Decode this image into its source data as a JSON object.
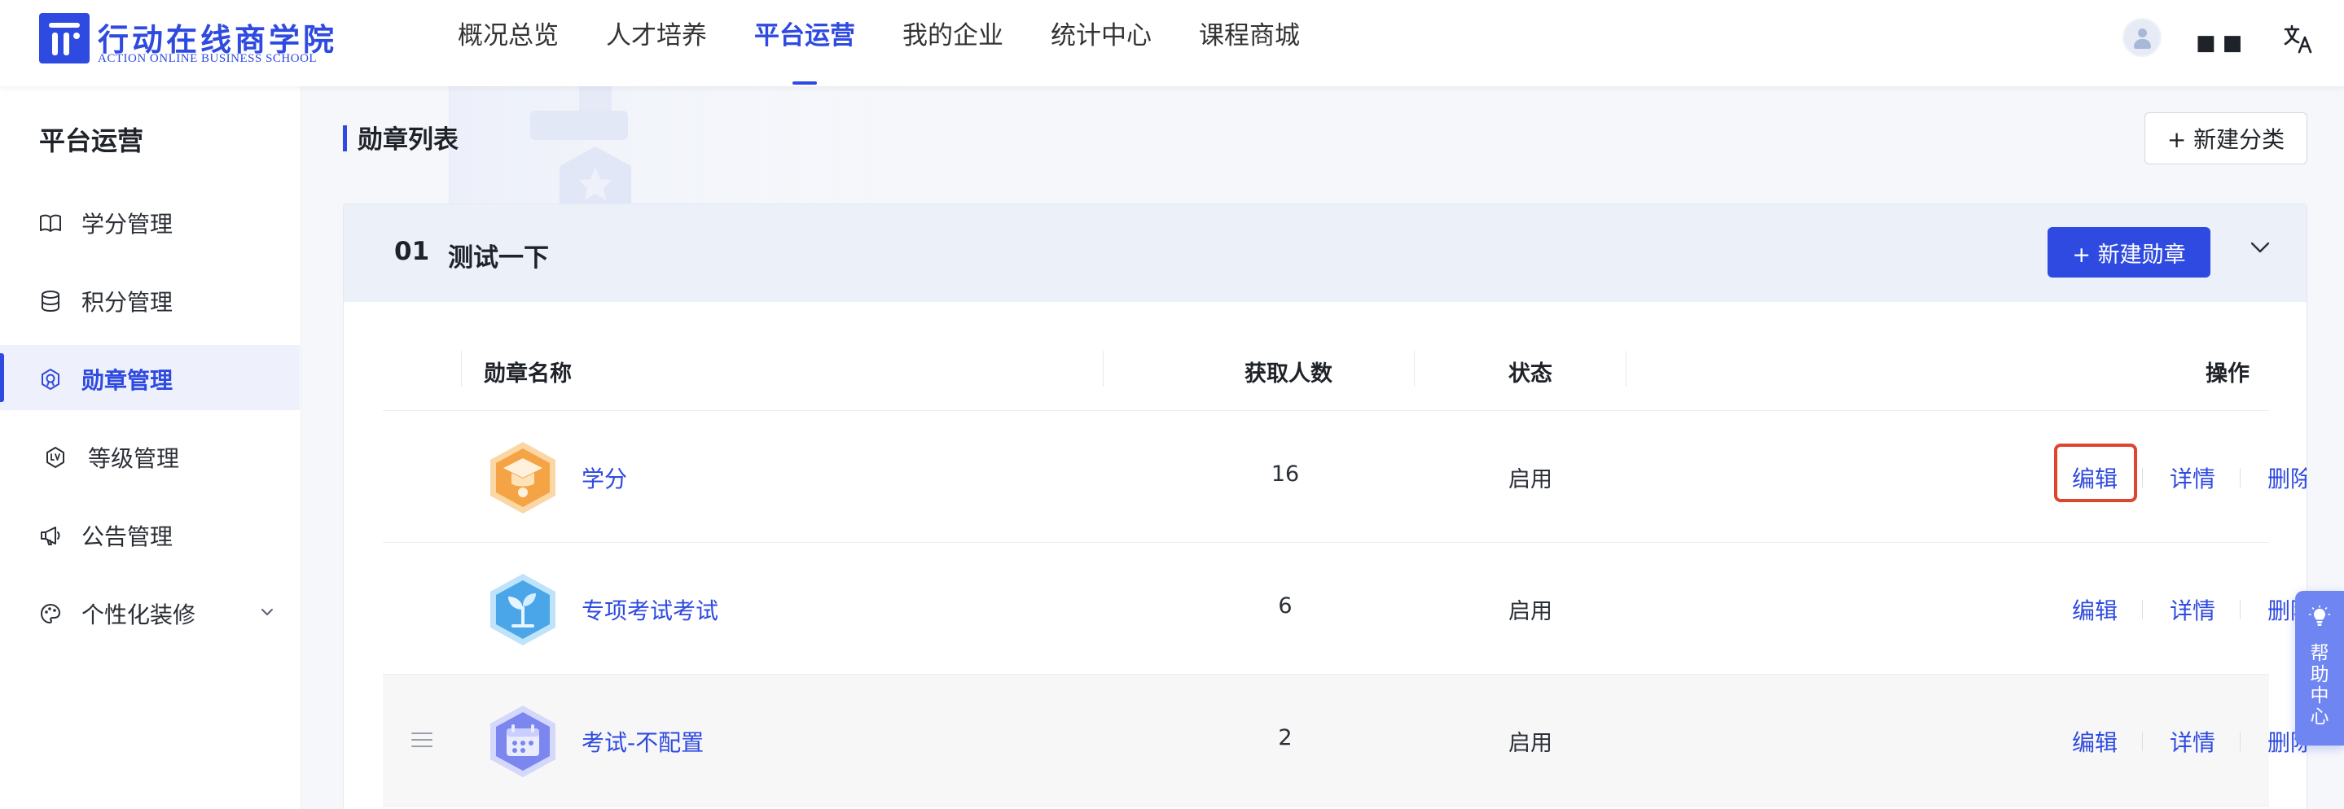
{
  "brand": {
    "name_cn": "行动在线商学院",
    "name_en": "ACTION ONLINE BUSINESS SCHOOL",
    "color": "#2f4ae0"
  },
  "nav": {
    "items": [
      {
        "label": "概况总览"
      },
      {
        "label": "人才培养"
      },
      {
        "label": "平台运营",
        "active": true
      },
      {
        "label": "我的企业"
      },
      {
        "label": "统计中心"
      },
      {
        "label": "课程商城"
      }
    ]
  },
  "user": {
    "avatar_icon": "user-avatar-icon",
    "name": "■■"
  },
  "language_icon": "translate-icon",
  "sidebar": {
    "title": "平台运营",
    "items": [
      {
        "label": "学分管理",
        "icon": "book-icon"
      },
      {
        "label": "积分管理",
        "icon": "database-icon"
      },
      {
        "label": "勋章管理",
        "icon": "medal-icon",
        "active": true
      },
      {
        "label": "等级管理",
        "icon": "level-icon"
      },
      {
        "label": "公告管理",
        "icon": "megaphone-icon"
      },
      {
        "label": "个性化装修",
        "icon": "palette-icon",
        "expandable": true
      }
    ]
  },
  "main": {
    "title": "勋章列表",
    "new_category_label": "+ 新建分类",
    "category": {
      "index": "01",
      "name": "测试一下",
      "new_badge_label": "+ 新建勋章",
      "table": {
        "headers": {
          "name": "勋章名称",
          "count": "获取人数",
          "status": "状态",
          "actions": "操作"
        },
        "rows": [
          {
            "name": "学分",
            "count": "16",
            "status": "启用",
            "badge_color": "#f4a445",
            "badge_icon": "mortarboard-icon"
          },
          {
            "name": "专项考试考试",
            "count": "6",
            "status": "启用",
            "badge_color": "#4aa6e8",
            "badge_icon": "sprout-icon"
          },
          {
            "name": "考试-不配置",
            "count": "2",
            "status": "启用",
            "badge_color": "#7b86ee",
            "badge_icon": "calendar-icon"
          }
        ],
        "actions": {
          "edit": "编辑",
          "detail": "详情",
          "delete": "删除"
        }
      }
    }
  },
  "help": {
    "label": "帮助中心",
    "icon": "lightbulb-icon"
  }
}
